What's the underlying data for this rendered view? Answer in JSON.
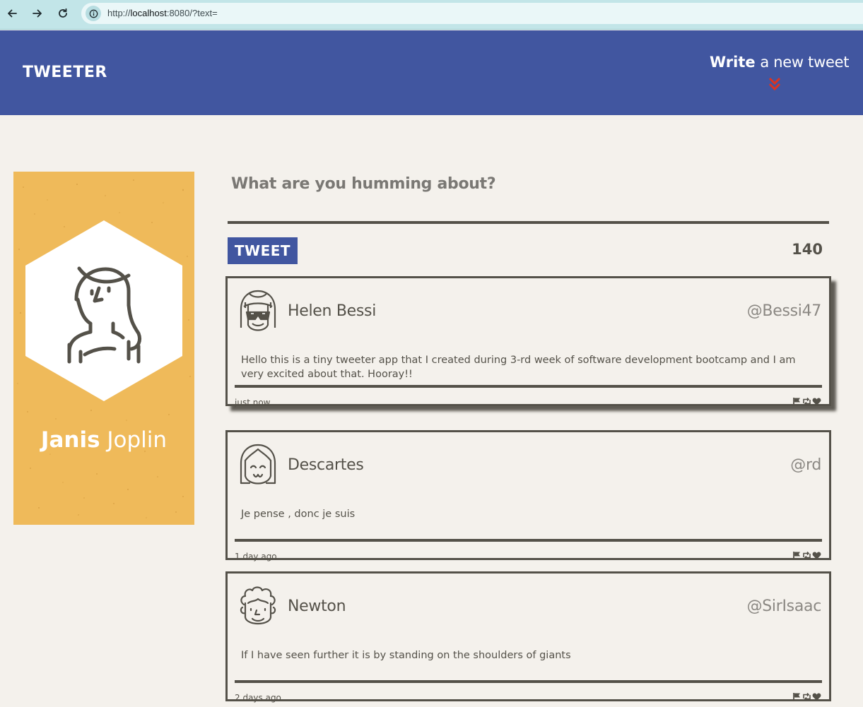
{
  "browser": {
    "url_prefix": "http://",
    "url_host": "localhost",
    "url_rest": ":8080/?text="
  },
  "header": {
    "logo": "TWEETER",
    "write_bold": "Write",
    "write_rest": "a new tweet"
  },
  "profile": {
    "first_name": "Janis",
    "last_name": "Joplin"
  },
  "composer": {
    "prompt": "What are you humming about?",
    "button_label": "TWEET",
    "counter": "140"
  },
  "tweets": [
    {
      "name": "Helen Bessi",
      "handle": "@Bessi47",
      "text": "Hello this is a tiny tweeter app that I created during 3-rd week of software development bootcamp and I am very excited about that. Hooray!!",
      "time": "just now",
      "avatar": "girl-glasses-icon"
    },
    {
      "name": "Descartes",
      "handle": "@rd",
      "text": "Je pense , donc je suis",
      "time": "1 day ago",
      "avatar": "smiling-girl-icon"
    },
    {
      "name": "Newton",
      "handle": "@SirIsaac",
      "text": "If I have seen further it is by standing on the shoulders of giants",
      "time": "2 days ago",
      "avatar": "curly-hair-man-icon"
    }
  ],
  "colors": {
    "header": "#4156a0",
    "profile": "#efba5a",
    "background": "#f4f1ec",
    "ink": "#545149",
    "accent": "#e0331f"
  }
}
